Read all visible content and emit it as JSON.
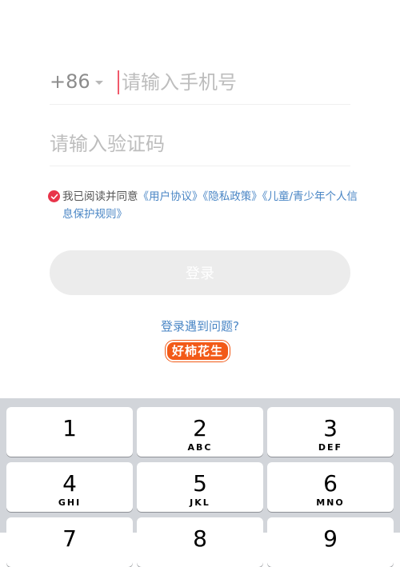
{
  "login": {
    "country_code": "+86",
    "phone_placeholder": "请输入手机号",
    "code_placeholder": "请输入验证码",
    "agreement_prefix": "我已阅读并同意",
    "link_user_agreement": "《用户协议》",
    "link_privacy": "《隐私政策》",
    "link_children": "《儿童/青少年个人信息保护规则》",
    "login_button": "登录",
    "problem_link": "登录遇到问题?"
  },
  "watermark": "好柿花生",
  "colors": {
    "link": "#4a86c5",
    "check": "#e8344a",
    "caret": "#f05a6b",
    "button_disabled": "#ececec",
    "keypad_bg": "#d2d5da"
  },
  "keypad": {
    "keys": [
      {
        "num": "1",
        "letters": ""
      },
      {
        "num": "2",
        "letters": "ABC"
      },
      {
        "num": "3",
        "letters": "DEF"
      },
      {
        "num": "4",
        "letters": "GHI"
      },
      {
        "num": "5",
        "letters": "JKL"
      },
      {
        "num": "6",
        "letters": "MNO"
      },
      {
        "num": "7",
        "letters": ""
      },
      {
        "num": "8",
        "letters": ""
      },
      {
        "num": "9",
        "letters": ""
      }
    ]
  }
}
